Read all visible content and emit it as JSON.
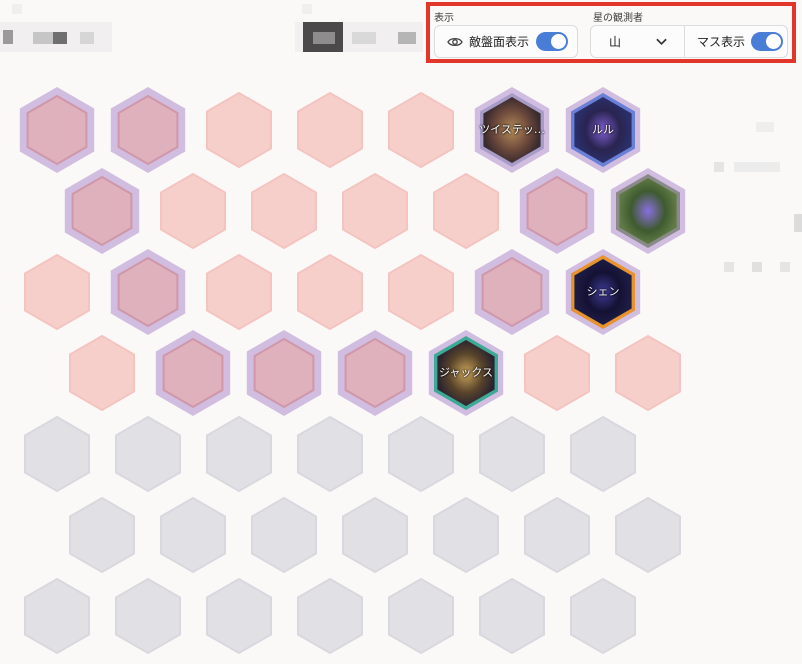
{
  "panel": {
    "display_group_label": "表示",
    "enemy_board_label": "敵盤面表示",
    "enemy_board_on": true,
    "star_observer_label": "星の観測者",
    "star_observer_value": "山",
    "grid_label": "マス表示",
    "grid_on": true
  },
  "units": [
    {
      "name": "ツイステッ…"
    },
    {
      "name": "ルル"
    },
    {
      "name": "シェン"
    },
    {
      "name": "ジャックス"
    }
  ],
  "colors": {
    "highlight": "#e2362b",
    "toggle": "#4a7dd6",
    "ally_hex": "#f6cfcb",
    "selected_hex": "#dfb1bc",
    "selected_ring": "#d1bde0",
    "enemy_hex": "#e1e1e5",
    "border_teal": "#3ea996",
    "border_orange": "#e7942e",
    "border_blue": "#6a7fd6",
    "border_purple": "#a79bc8"
  }
}
